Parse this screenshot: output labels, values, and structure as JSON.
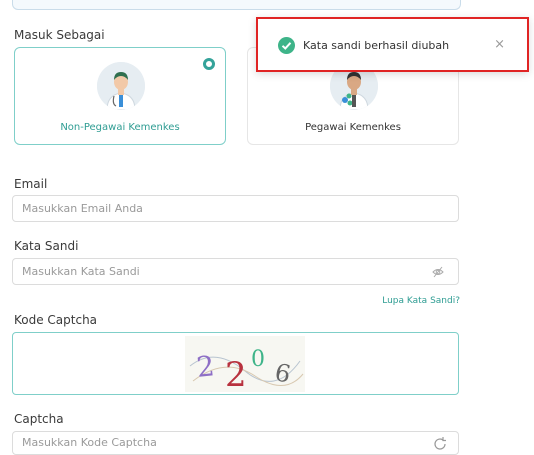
{
  "login_as": {
    "label": "Masuk Sebagai",
    "options": [
      {
        "label": "Non-Pegawai Kemenkes",
        "selected": true
      },
      {
        "label": "Pegawai Kemenkes",
        "selected": false
      }
    ]
  },
  "email": {
    "label": "Email",
    "placeholder": "Masukkan Email Anda"
  },
  "password": {
    "label": "Kata Sandi",
    "placeholder": "Masukkan Kata Sandi",
    "forgot_link": "Lupa Kata Sandi?"
  },
  "captcha_image": {
    "label": "Kode Captcha",
    "code": "2206"
  },
  "captcha_input": {
    "label": "Captcha",
    "placeholder": "Masukkan Kode Captcha"
  },
  "toast": {
    "message": "Kata sandi berhasil diubah",
    "close": "×"
  },
  "colors": {
    "accent": "#2f9d93",
    "success": "#3eb489",
    "highlight": "#e02424"
  }
}
